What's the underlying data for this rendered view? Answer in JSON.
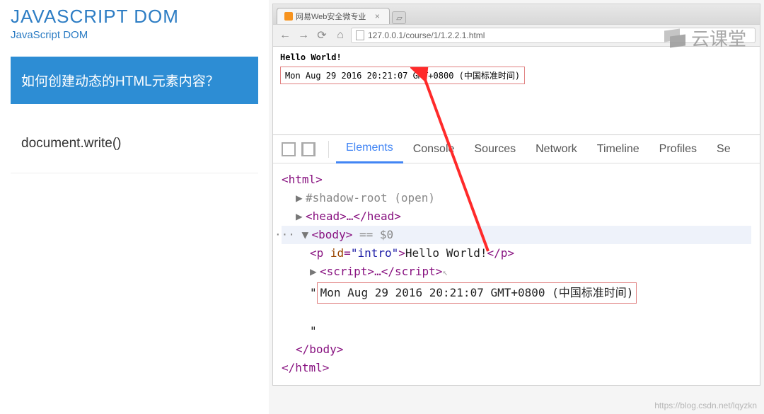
{
  "sidebar": {
    "title_main": "JAVASCRIPT DOM",
    "title_sub": "JavaScript DOM",
    "question": "如何创建动态的HTML元素内容？",
    "code": "document.write()"
  },
  "browser": {
    "tab_title": "网易Web安全微专业",
    "url": "127.0.0.1/course/1/1.2.2.1.html",
    "page_hello": "Hello World!",
    "page_date": "Mon Aug 29 2016 20:21:07 GMT+0800 (中国标准时间)"
  },
  "devtools": {
    "tabs": [
      "Elements",
      "Console",
      "Sources",
      "Network",
      "Timeline",
      "Profiles",
      "Se"
    ],
    "active_tab": "Elements",
    "dom": {
      "html_open": "<html>",
      "shadow": "#shadow-root (open)",
      "head": "<head>…</head>",
      "body_open": "<body>",
      "body_sel": " == $0",
      "p_open": "<p ",
      "p_attr_name": "id",
      "p_attr_val": "\"intro\"",
      "p_text": "Hello World!",
      "p_close": "</p>",
      "script": "<script>…</scr",
      "script_suffix": "ipt>",
      "date_quote_open": "\"",
      "date_text": "Mon Aug 29 2016 20:21:07 GMT+0800 (中国标准时间)",
      "date_quote_close": "\"",
      "body_close": "</body>",
      "html_close": "</html>"
    }
  },
  "watermark": "云课堂",
  "footer": "https://blog.csdn.net/lqyzkn"
}
